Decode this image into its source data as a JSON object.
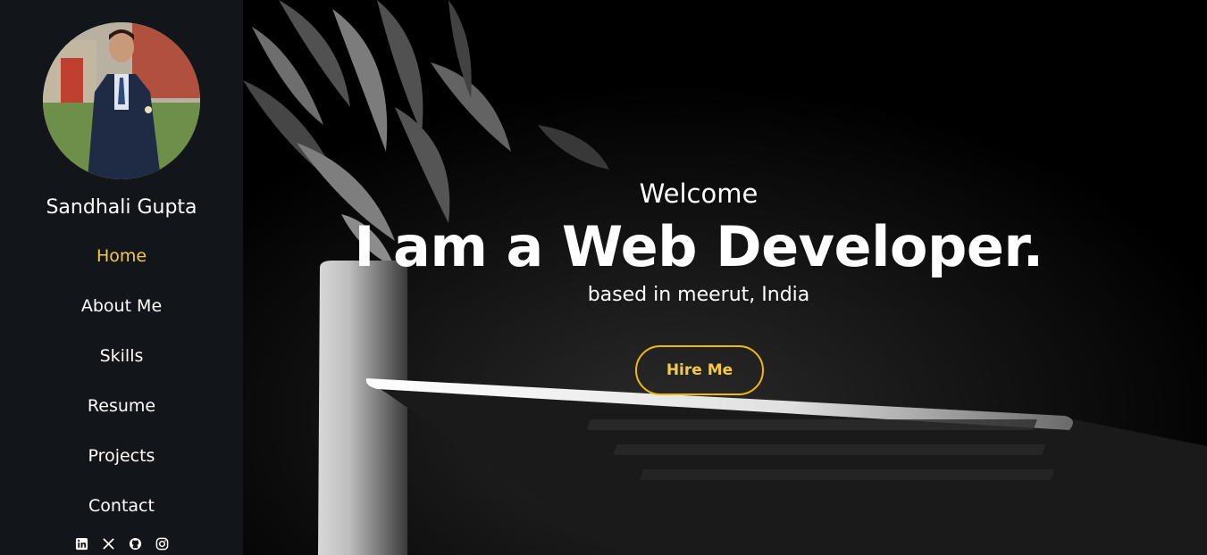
{
  "sidebar": {
    "profile_name": "Sandhali Gupta",
    "nav": [
      {
        "label": "Home",
        "active": true
      },
      {
        "label": "About Me",
        "active": false
      },
      {
        "label": "Skills",
        "active": false
      },
      {
        "label": "Resume",
        "active": false
      },
      {
        "label": "Projects",
        "active": false
      },
      {
        "label": "Contact",
        "active": false
      }
    ],
    "socials": [
      "linkedin-icon",
      "x-twitter-icon",
      "github-icon",
      "instagram-icon"
    ]
  },
  "hero": {
    "welcome": "Welcome",
    "headline": "I am a Web Developer.",
    "subline": "based in meerut, India",
    "cta_label": "Hire Me"
  },
  "colors": {
    "sidebar_bg": "#121519",
    "accent": "#f6c945",
    "button_border": "#f0b90b",
    "text": "#ffffff"
  }
}
